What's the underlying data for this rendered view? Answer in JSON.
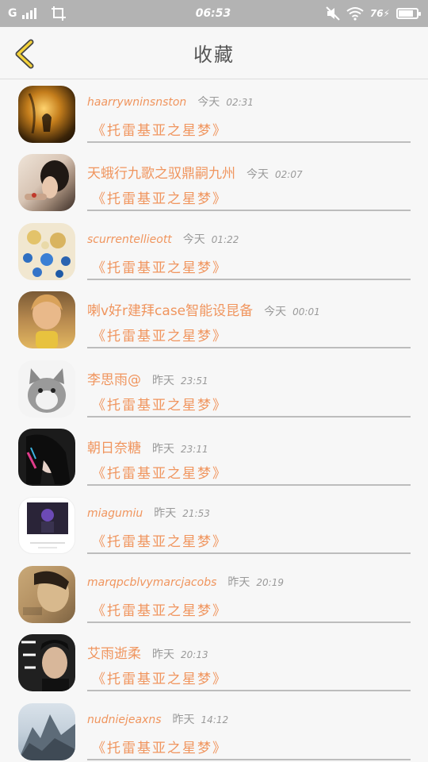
{
  "status_bar": {
    "carrier": "G",
    "time": "06:53",
    "battery": "76"
  },
  "header": {
    "title": "收藏"
  },
  "items": [
    {
      "name": "haarrywninsnston",
      "date": "今天",
      "time": "02:31",
      "content": "《托雷基亚之星梦》"
    },
    {
      "name": "天蛾行九歌之驭鼎嗣九州",
      "date": "今天",
      "time": "02:07",
      "content": "《托雷基亚之星梦》"
    },
    {
      "name": "scurrentellieott",
      "date": "今天",
      "time": "01:22",
      "content": "《托雷基亚之星梦》"
    },
    {
      "name": "喇v好r建拜case智能设昆备",
      "date": "今天",
      "time": "00:01",
      "content": "《托雷基亚之星梦》"
    },
    {
      "name": "李思雨@",
      "date": "昨天",
      "time": "23:51",
      "content": "《托雷基亚之星梦》"
    },
    {
      "name": "朝日奈糖",
      "date": "昨天",
      "time": "23:11",
      "content": "《托雷基亚之星梦》"
    },
    {
      "name": "miagumiu",
      "date": "昨天",
      "time": "21:53",
      "content": "《托雷基亚之星梦》"
    },
    {
      "name": "marqpcblvymarcjacobs",
      "date": "昨天",
      "time": "20:19",
      "content": "《托雷基亚之星梦》"
    },
    {
      "name": "艾雨逝柔",
      "date": "昨天",
      "time": "20:13",
      "content": "《托雷基亚之星梦》"
    },
    {
      "name": "nudniejeaxns",
      "date": "昨天",
      "time": "14:12",
      "content": "《托雷基亚之星梦》"
    }
  ]
}
